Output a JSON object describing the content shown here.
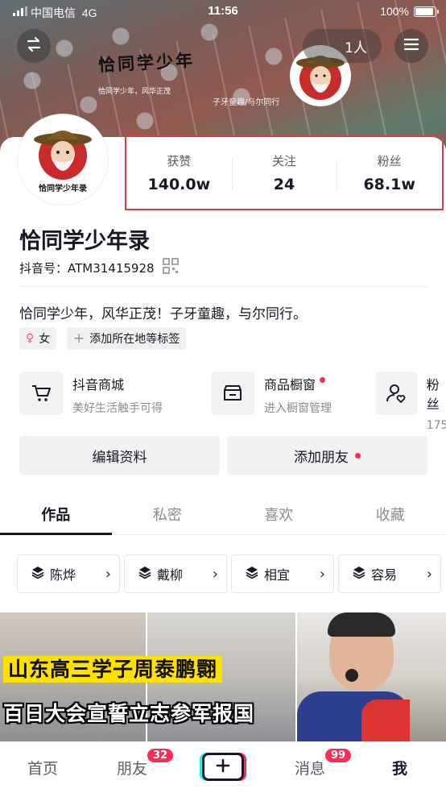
{
  "status_bar": {
    "carrier": "中国电信",
    "network": "4G",
    "time": "11:56",
    "battery_percent": "100%"
  },
  "header": {
    "back_icon": "swap-arrows-icon",
    "visitors_label": "1人",
    "menu_icon": "hamburger-menu-icon",
    "banner_title": "恰同学少年",
    "banner_subtitle": "恰同学少年，风华正茂",
    "banner_slogan": "子牙童趣/与尔同行"
  },
  "profile": {
    "avatar_caption": "恰同学少年录",
    "name": "恰同学少年录",
    "douyin_id": "抖音号：ATM31415928",
    "bio": "恰同学少年，风华正茂！子牙童趣，与尔同行。",
    "gender_tag": "女",
    "add_tag_label": "添加所在地等标签"
  },
  "stats": [
    {
      "label": "获赞",
      "value": "140.0w"
    },
    {
      "label": "关注",
      "value": "24"
    },
    {
      "label": "粉丝",
      "value": "68.1w"
    }
  ],
  "services": [
    {
      "title": "抖音商城",
      "subtitle": "美好生活触手可得",
      "icon": "cart-icon"
    },
    {
      "title": "商品橱窗",
      "subtitle": "进入橱窗管理",
      "icon": "storefront-icon",
      "has_dot": true
    },
    {
      "title": "粉丝",
      "subtitle": "175",
      "icon": "fans-heart-icon"
    }
  ],
  "actions": {
    "edit_profile": "编辑资料",
    "add_friend": "添加朋友"
  },
  "tabs": [
    "作品",
    "私密",
    "喜欢",
    "收藏"
  ],
  "active_tab": "作品",
  "collections": [
    "陈烨",
    "戴柳",
    "相宜",
    "容易"
  ],
  "video_captions": {
    "line1": "山东高三学子周泰鹏翾",
    "line2": "百日大会宣誓立志参军报国"
  },
  "bottom_nav": {
    "home": "首页",
    "friends": "朋友",
    "friends_badge": "32",
    "create_icon": "plus-icon",
    "messages": "消息",
    "messages_badge": "99",
    "me": "我"
  },
  "colors": {
    "accent": "#fe2c55",
    "stats_highlight_border": "#e33a3a",
    "text_primary": "#161823",
    "text_secondary": "#8a8b91"
  }
}
